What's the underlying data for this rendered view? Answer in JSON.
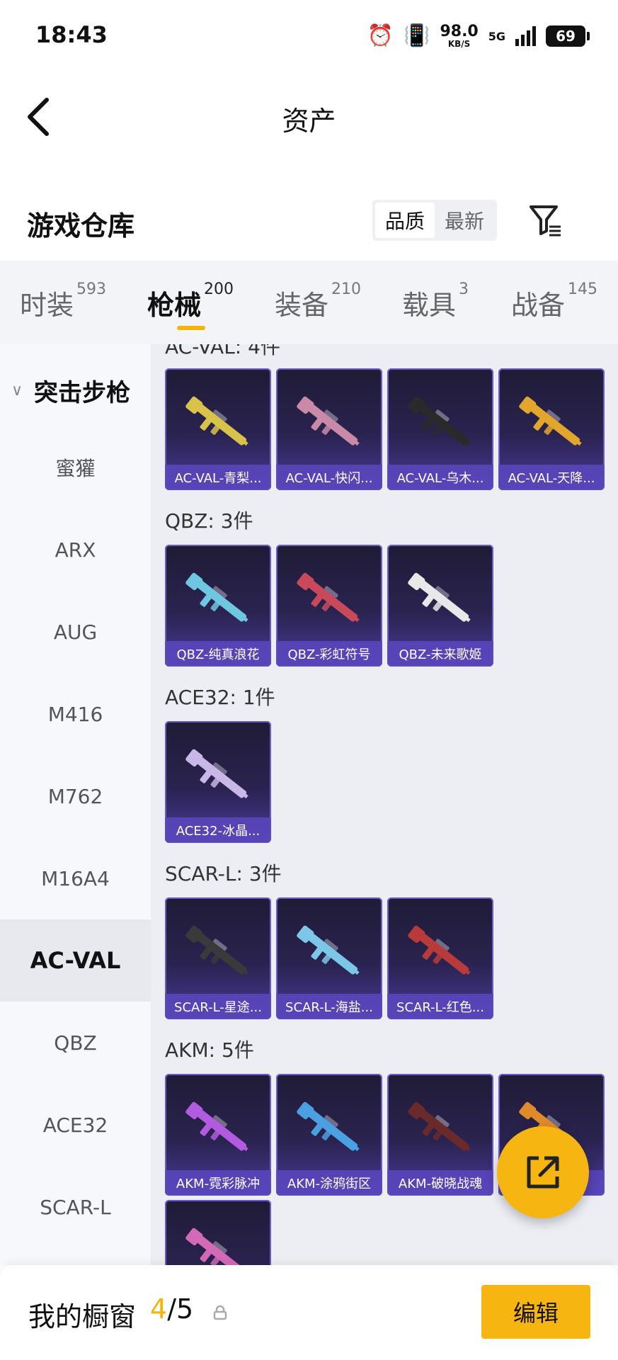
{
  "status_bar": {
    "time": "18:43",
    "net_speed": "98.0",
    "net_unit": "KB/S",
    "network": "5G",
    "battery": "69"
  },
  "header": {
    "title": "资产"
  },
  "warehouse": {
    "title": "游戏仓库",
    "sort_options": [
      "品质",
      "最新"
    ],
    "sort_selected": "品质"
  },
  "tabs": [
    {
      "label": "时装",
      "count": "593"
    },
    {
      "label": "枪械",
      "count": "200"
    },
    {
      "label": "装备",
      "count": "210"
    },
    {
      "label": "载具",
      "count": "3"
    },
    {
      "label": "战备",
      "count": "145"
    }
  ],
  "sidebar": {
    "group": "突击步枪",
    "items": [
      "蜜獾",
      "ARX",
      "AUG",
      "M416",
      "M762",
      "M16A4",
      "AC-VAL",
      "QBZ",
      "ACE32",
      "SCAR-L"
    ],
    "selected": "AC-VAL"
  },
  "sections": [
    {
      "title": "AC-VAL: 4件",
      "items": [
        "AC-VAL-青梨...",
        "AC-VAL-快闪...",
        "AC-VAL-乌木...",
        "AC-VAL-天降..."
      ],
      "colors": [
        "#d9c24a",
        "#c98aa8",
        "#2a2a2a",
        "#e3a62c"
      ]
    },
    {
      "title": "QBZ: 3件",
      "items": [
        "QBZ-纯真浪花",
        "QBZ-彩虹符号",
        "QBZ-未来歌姬"
      ],
      "colors": [
        "#6ec6e0",
        "#c84a5a",
        "#e8e8e8"
      ]
    },
    {
      "title": "ACE32: 1件",
      "items": [
        "ACE32-冰晶..."
      ],
      "colors": [
        "#c9b7e8"
      ]
    },
    {
      "title": "SCAR-L: 3件",
      "items": [
        "SCAR-L-星途...",
        "SCAR-L-海盐...",
        "SCAR-L-红色..."
      ],
      "colors": [
        "#3a3a3a",
        "#7cc7e8",
        "#b83a3a"
      ]
    },
    {
      "title": "AKM: 5件",
      "items": [
        "AKM-霓彩脉冲",
        "AKM-涂鸦街区",
        "AKM-破晓战魂",
        "",
        ""
      ],
      "colors": [
        "#b25be0",
        "#4aa0e0",
        "#6a2a2a",
        "#e08a2a",
        "#d36ab8"
      ]
    }
  ],
  "showcase": {
    "label": "我的橱窗",
    "current": "4",
    "total": "/5",
    "edit_label": "编辑"
  },
  "accent": "#f7b511"
}
